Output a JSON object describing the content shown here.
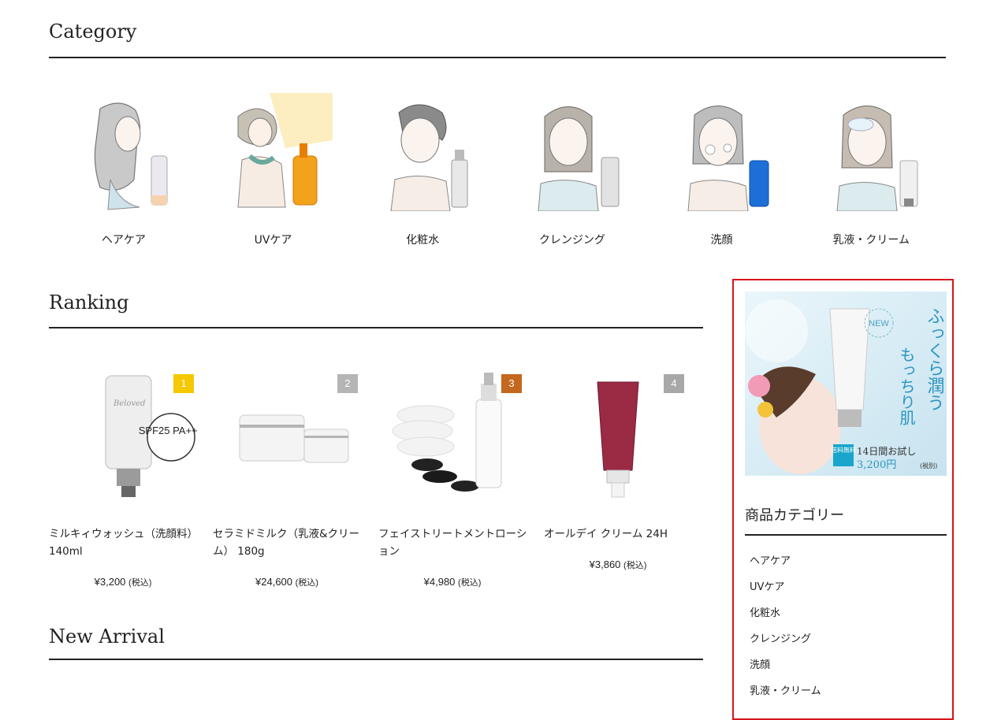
{
  "sections": {
    "category": "Category",
    "ranking": "Ranking",
    "new_arrival": "New Arrival"
  },
  "categories": [
    {
      "label": "ヘアケア",
      "icon": "hair-care-illustration-icon"
    },
    {
      "label": "UVケア",
      "icon": "uv-care-illustration-icon"
    },
    {
      "label": "化粧水",
      "icon": "toner-illustration-icon"
    },
    {
      "label": "クレンジング",
      "icon": "cleansing-illustration-icon"
    },
    {
      "label": "洗顔",
      "icon": "face-wash-illustration-icon"
    },
    {
      "label": "乳液・クリーム",
      "icon": "milk-cream-illustration-icon"
    }
  ],
  "ranking": [
    {
      "rank": "1",
      "badge_color": "#f5c800",
      "name": "ミルキィウォッシュ（洗顔料） 140ml",
      "price": "¥3,200",
      "tax": "(税込)",
      "product_text": "SPF25 PA+++"
    },
    {
      "rank": "2",
      "badge_color": "#b5b5b5",
      "name": "セラミドミルク（乳液&クリーム） 180g",
      "price": "¥24,600",
      "tax": "(税込)"
    },
    {
      "rank": "3",
      "badge_color": "#c4671f",
      "name": "フェイストリートメントローション",
      "price": "¥4,980",
      "tax": "(税込)"
    },
    {
      "rank": "4",
      "badge_color": "#a8a8a8",
      "name": "オールデイ クリーム 24H",
      "price": "¥3,860",
      "tax": "(税込)"
    }
  ],
  "sidebar": {
    "banner": {
      "new": "NEW",
      "line1": "ふっくら潤う",
      "line2": "もっちり肌",
      "free_shipping": "送料無料",
      "trial": "14日間お試し",
      "price": "3,200円",
      "tax": "(税別)"
    },
    "title": "商品カテゴリー",
    "items": [
      "ヘアケア",
      "UVケア",
      "化粧水",
      "クレンジング",
      "洗顔",
      "乳液・クリーム"
    ]
  },
  "colors": {
    "accent_border": "#d8141b",
    "text": "#222222",
    "banner_bg": "#d7ecf4"
  }
}
